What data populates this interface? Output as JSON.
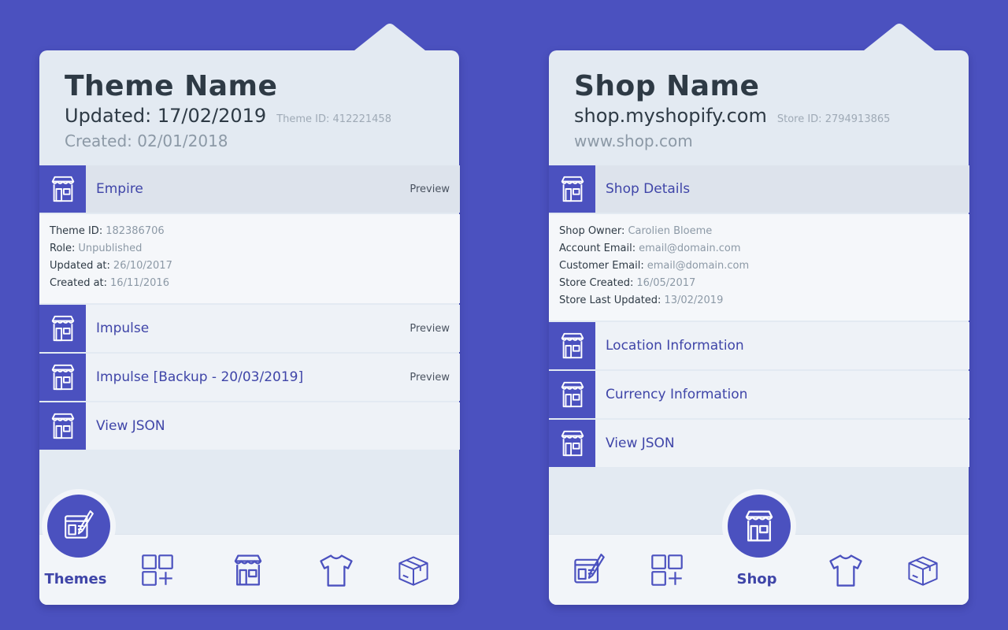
{
  "theme_panel": {
    "title": "Theme Name",
    "updated": "Updated: 17/02/2019",
    "theme_id": "Theme ID: 412221458",
    "created": "Created: 02/01/2018",
    "rows": [
      {
        "label": "Empire",
        "preview": "Preview"
      },
      {
        "label": "Impulse",
        "preview": "Preview"
      },
      {
        "label": "Impulse [Backup - 20/03/2019]",
        "preview": "Preview"
      },
      {
        "label": "View JSON"
      }
    ],
    "details": [
      {
        "key": "Theme ID:",
        "value": "182386706"
      },
      {
        "key": "Role:",
        "value": "Unpublished"
      },
      {
        "key": "Updated at:",
        "value": "26/10/2017"
      },
      {
        "key": "Created at:",
        "value": "16/11/2016"
      }
    ],
    "nav_active_label": "Themes"
  },
  "shop_panel": {
    "title": "Shop Name",
    "domain": "shop.myshopify.com",
    "store_id": "Store ID: 2794913865",
    "website": "www.shop.com",
    "rows": [
      {
        "label": "Shop Details"
      },
      {
        "label": "Location Information"
      },
      {
        "label": "Currency Information"
      },
      {
        "label": "View JSON"
      }
    ],
    "details": [
      {
        "key": "Shop Owner:",
        "value": "Carolien Bloeme"
      },
      {
        "key": "Account Email:",
        "value": "email@domain.com"
      },
      {
        "key": "Customer Email:",
        "value": "email@domain.com"
      },
      {
        "key": "Store Created:",
        "value": "16/05/2017"
      },
      {
        "key": "Store Last Updated:",
        "value": "13/02/2019"
      }
    ],
    "nav_active_label": "Shop"
  },
  "colors": {
    "background": "#4B51BF",
    "accent": "#4B51BF",
    "panel": "#E3EAF2"
  },
  "icons": [
    "store-icon",
    "theme-edit-icon",
    "apps-add-icon",
    "shirt-icon",
    "box-icon"
  ]
}
